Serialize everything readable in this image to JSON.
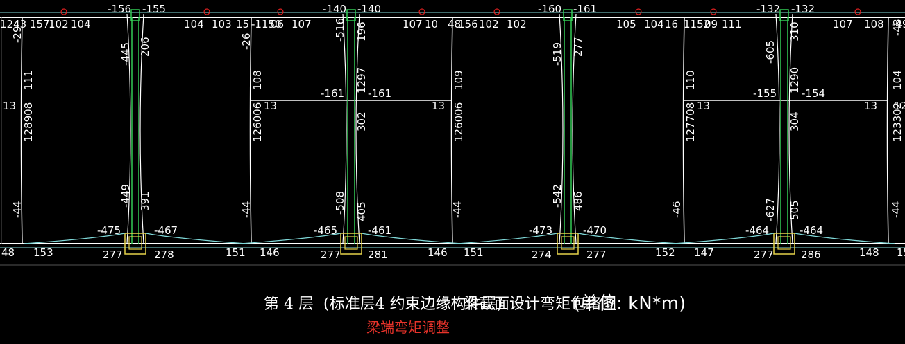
{
  "drawing": {
    "title_main": "第 4 层",
    "title_paren": "(标准层4 约束边缘构件层)",
    "title_desc": "梁截面设计弯矩包络图",
    "title_unit": "(单位: kN*m)",
    "subtitle": "梁端弯矩调整"
  },
  "colors": {
    "background": "#000000",
    "frame": "#ffffff",
    "envelope": "#7fd8d8",
    "column": "#33cc55",
    "support": "#e6d24a",
    "marker": "#e02020",
    "subtitle": "#e8332a"
  },
  "labels": {
    "top": [
      "-156",
      "-155",
      "-140",
      "-140",
      "-160",
      "-161",
      "-132",
      "-132"
    ],
    "top_edge": [
      "1243 157",
      "102",
      "104",
      "104",
      "103",
      "15",
      "-1150",
      "06",
      "107",
      "107",
      "10",
      "48",
      "156",
      "102",
      "102",
      "105",
      "104",
      "16",
      "1152",
      "09",
      "111",
      "107",
      "108",
      "-49"
    ],
    "bottom": [
      "-475",
      "-467",
      "-465",
      "-461",
      "-473",
      "-470",
      "-464",
      "-464"
    ],
    "bottom_edge": [
      "48",
      "153",
      "277",
      "278",
      "151",
      "146",
      "277",
      "281",
      "146",
      "151",
      "274",
      "277",
      "152",
      "147",
      "277",
      "286",
      "148",
      "15"
    ],
    "mid_beam": [
      "-161",
      "-161",
      "-155",
      "-154",
      "13",
      "13",
      "13",
      "13",
      "13",
      "12"
    ],
    "vertical": [
      "-445",
      "206",
      "-449",
      "391",
      "-516",
      "196",
      "1297",
      "302",
      "-508",
      "405",
      "-519",
      "277",
      "-542",
      "486",
      "-605",
      "310",
      "1290",
      "304",
      "-627",
      "505",
      "111",
      "128908",
      "108",
      "126006",
      "109",
      "126006",
      "110",
      "127708",
      "104",
      "123302",
      "-44",
      "-44",
      "-44",
      "-46",
      "-44",
      "-29",
      "-26",
      "-48"
    ]
  }
}
